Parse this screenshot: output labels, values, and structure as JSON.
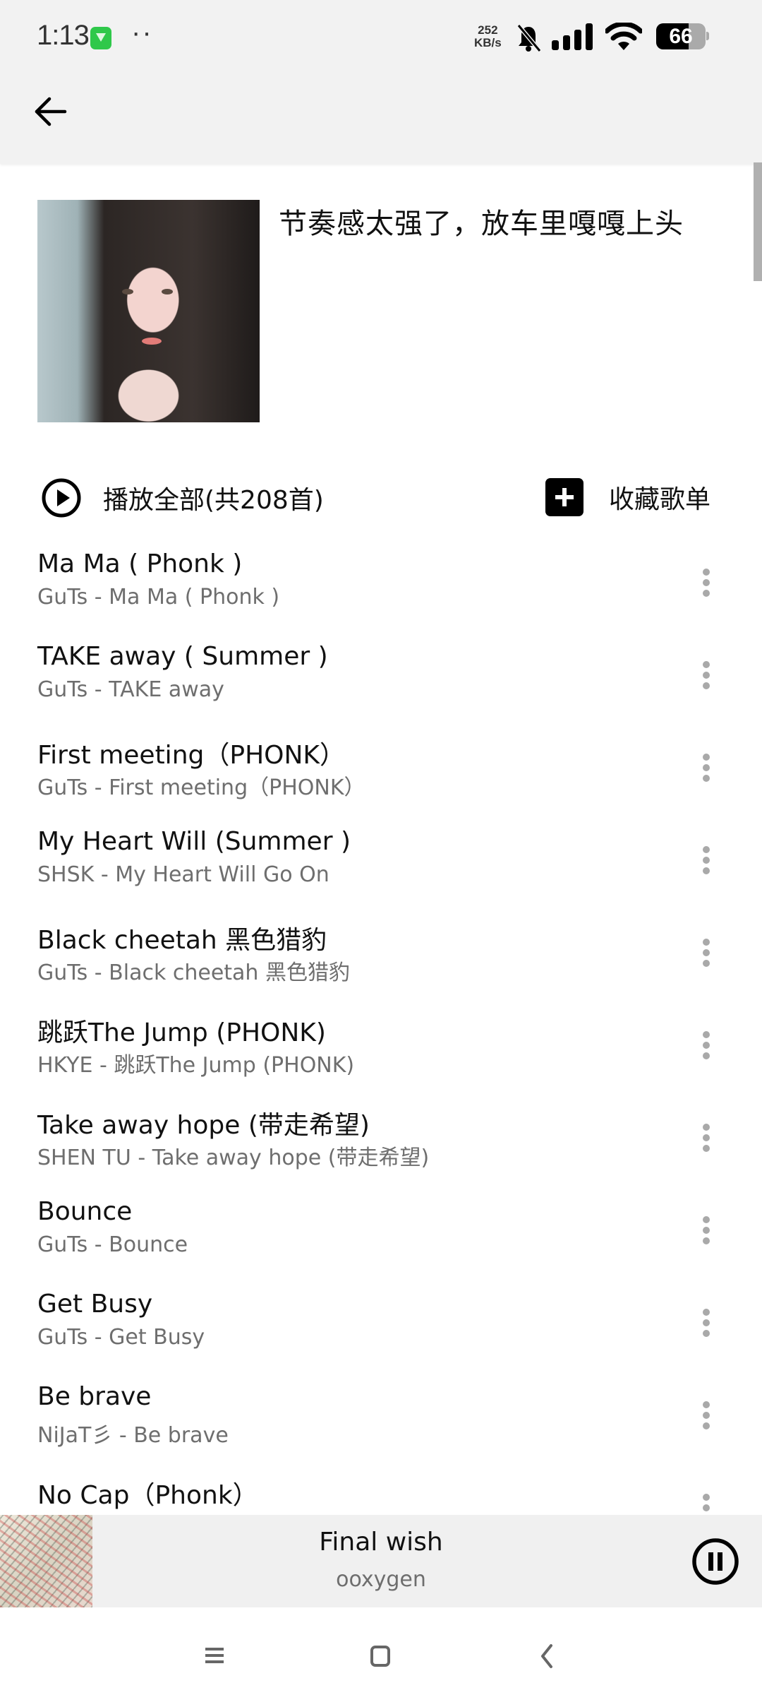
{
  "status_bar": {
    "time": "1:13",
    "dots": "··",
    "net_speed_value": "252",
    "net_speed_unit": "KB/s",
    "battery_level": "66",
    "battery_fraction": 0.66,
    "icons": [
      "app-download-icon",
      "mute-bell-icon",
      "signal-icon",
      "wifi-icon",
      "battery-icon"
    ]
  },
  "app_bar": {
    "back_icon": "arrow-left-icon"
  },
  "playlist": {
    "title": "节奏感太强了，放车里嘎嘎上头",
    "play_all_label": "播放全部(共208首)",
    "collect_label": "收藏歌单"
  },
  "songs": [
    {
      "title": "Ma Ma ( Phonk )",
      "subtitle": "GuTs - Ma Ma ( Phonk )"
    },
    {
      "title": "TAKE away ( Summer )",
      "subtitle": "GuTs - TAKE away"
    },
    {
      "title": "First meeting（PHONK）",
      "subtitle": "GuTs - First meeting（PHONK）"
    },
    {
      "title": "My Heart Will (Summer )",
      "subtitle": "SHSK - My Heart Will Go On"
    },
    {
      "title": "Black cheetah 黑色猎豹",
      "subtitle": "GuTs - Black cheetah 黑色猎豹"
    },
    {
      "title": "跳跃The Jump (PHONK)",
      "subtitle": "HKYE - 跳跃The Jump (PHONK)"
    },
    {
      "title": "Take away hope (带走希望)",
      "subtitle": "SHEN TU - Take away hope (带走希望)"
    },
    {
      "title": "Bounce",
      "subtitle": "GuTs - Bounce"
    },
    {
      "title": "Get Busy",
      "subtitle": "GuTs - Get Busy"
    },
    {
      "title": "Be brave",
      "subtitle": "NiJaT彡 - Be brave"
    },
    {
      "title": "No Cap（Phonk）",
      "subtitle": ""
    }
  ],
  "now_playing": {
    "title": "Final wish",
    "artist": "ooxygen",
    "state": "playing"
  },
  "nav_bar": {
    "buttons": [
      "menu-icon",
      "home-icon",
      "back-icon"
    ]
  }
}
